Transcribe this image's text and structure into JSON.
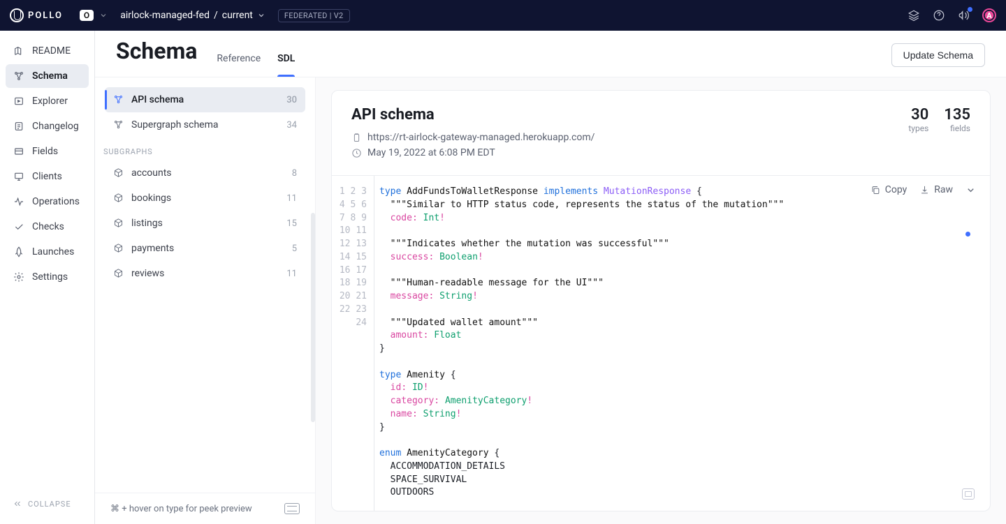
{
  "topbar": {
    "logo_text": "POLLO",
    "org_letter": "O",
    "breadcrumb_graph": "airlock-managed-fed",
    "breadcrumb_sep": "/",
    "breadcrumb_variant": "current",
    "fed_badge": "FEDERATED | V2",
    "avatar_letter": "A"
  },
  "nav": {
    "readme": "README",
    "schema": "Schema",
    "explorer": "Explorer",
    "changelog": "Changelog",
    "fields": "Fields",
    "clients": "Clients",
    "operations": "Operations",
    "checks": "Checks",
    "launches": "Launches",
    "settings": "Settings",
    "collapse": "COLLAPSE"
  },
  "page": {
    "title": "Schema",
    "tab_reference": "Reference",
    "tab_sdl": "SDL",
    "update_btn": "Update Schema"
  },
  "side": {
    "items": [
      {
        "label": "API schema",
        "count": "30"
      },
      {
        "label": "Supergraph schema",
        "count": "34"
      }
    ],
    "subhead": "SUBGRAPHS",
    "subgraphs": [
      {
        "label": "accounts",
        "count": "8"
      },
      {
        "label": "bookings",
        "count": "11"
      },
      {
        "label": "listings",
        "count": "15"
      },
      {
        "label": "payments",
        "count": "5"
      },
      {
        "label": "reviews",
        "count": "11"
      }
    ],
    "footer_hint": "⌘ + hover on type for peek preview"
  },
  "detail": {
    "title": "API schema",
    "url": "https://rt-airlock-gateway-managed.herokuapp.com/",
    "timestamp": "May 19, 2022 at 6:08 PM EDT",
    "types_count": "30",
    "types_label": "types",
    "fields_count": "135",
    "fields_label": "fields",
    "copy_label": "Copy",
    "raw_label": "Raw"
  },
  "code": {
    "lines": [
      [
        [
          "kw",
          "type"
        ],
        [
          "sp",
          " "
        ],
        [
          "name",
          "AddFundsToWalletResponse"
        ],
        [
          "sp",
          " "
        ],
        [
          "impl",
          "implements"
        ],
        [
          "sp",
          " "
        ],
        [
          "iface",
          "MutationResponse"
        ],
        [
          "sp",
          " "
        ],
        [
          "txt",
          "{"
        ]
      ],
      [
        [
          "sp",
          "  "
        ],
        [
          "str",
          "\"\"\"Similar to HTTP status code, represents the status of the mutation\"\"\""
        ]
      ],
      [
        [
          "sp",
          "  "
        ],
        [
          "field",
          "code"
        ],
        [
          "punct",
          ":"
        ],
        [
          "sp",
          " "
        ],
        [
          "type",
          "Int"
        ],
        [
          "punct",
          "!"
        ]
      ],
      [],
      [
        [
          "sp",
          "  "
        ],
        [
          "str",
          "\"\"\"Indicates whether the mutation was successful\"\"\""
        ]
      ],
      [
        [
          "sp",
          "  "
        ],
        [
          "field",
          "success"
        ],
        [
          "punct",
          ":"
        ],
        [
          "sp",
          " "
        ],
        [
          "type",
          "Boolean"
        ],
        [
          "punct",
          "!"
        ]
      ],
      [],
      [
        [
          "sp",
          "  "
        ],
        [
          "str",
          "\"\"\"Human-readable message for the UI\"\"\""
        ]
      ],
      [
        [
          "sp",
          "  "
        ],
        [
          "field",
          "message"
        ],
        [
          "punct",
          ":"
        ],
        [
          "sp",
          " "
        ],
        [
          "type",
          "String"
        ],
        [
          "punct",
          "!"
        ]
      ],
      [],
      [
        [
          "sp",
          "  "
        ],
        [
          "str",
          "\"\"\"Updated wallet amount\"\"\""
        ]
      ],
      [
        [
          "sp",
          "  "
        ],
        [
          "field",
          "amount"
        ],
        [
          "punct",
          ":"
        ],
        [
          "sp",
          " "
        ],
        [
          "type",
          "Float"
        ]
      ],
      [
        [
          "txt",
          "}"
        ]
      ],
      [],
      [
        [
          "kw",
          "type"
        ],
        [
          "sp",
          " "
        ],
        [
          "name",
          "Amenity"
        ],
        [
          "sp",
          " "
        ],
        [
          "txt",
          "{"
        ]
      ],
      [
        [
          "sp",
          "  "
        ],
        [
          "field",
          "id"
        ],
        [
          "punct",
          ":"
        ],
        [
          "sp",
          " "
        ],
        [
          "type",
          "ID"
        ],
        [
          "punct",
          "!"
        ]
      ],
      [
        [
          "sp",
          "  "
        ],
        [
          "field",
          "category"
        ],
        [
          "punct",
          ":"
        ],
        [
          "sp",
          " "
        ],
        [
          "type",
          "AmenityCategory"
        ],
        [
          "punct",
          "!"
        ]
      ],
      [
        [
          "sp",
          "  "
        ],
        [
          "field",
          "name"
        ],
        [
          "punct",
          ":"
        ],
        [
          "sp",
          " "
        ],
        [
          "type",
          "String"
        ],
        [
          "punct",
          "!"
        ]
      ],
      [
        [
          "txt",
          "}"
        ]
      ],
      [],
      [
        [
          "kw",
          "enum"
        ],
        [
          "sp",
          " "
        ],
        [
          "name",
          "AmenityCategory"
        ],
        [
          "sp",
          " "
        ],
        [
          "txt",
          "{"
        ]
      ],
      [
        [
          "sp",
          "  "
        ],
        [
          "txt",
          "ACCOMMODATION_DETAILS"
        ]
      ],
      [
        [
          "sp",
          "  "
        ],
        [
          "txt",
          "SPACE_SURVIVAL"
        ]
      ],
      [
        [
          "sp",
          "  "
        ],
        [
          "txt",
          "OUTDOORS"
        ]
      ]
    ]
  }
}
